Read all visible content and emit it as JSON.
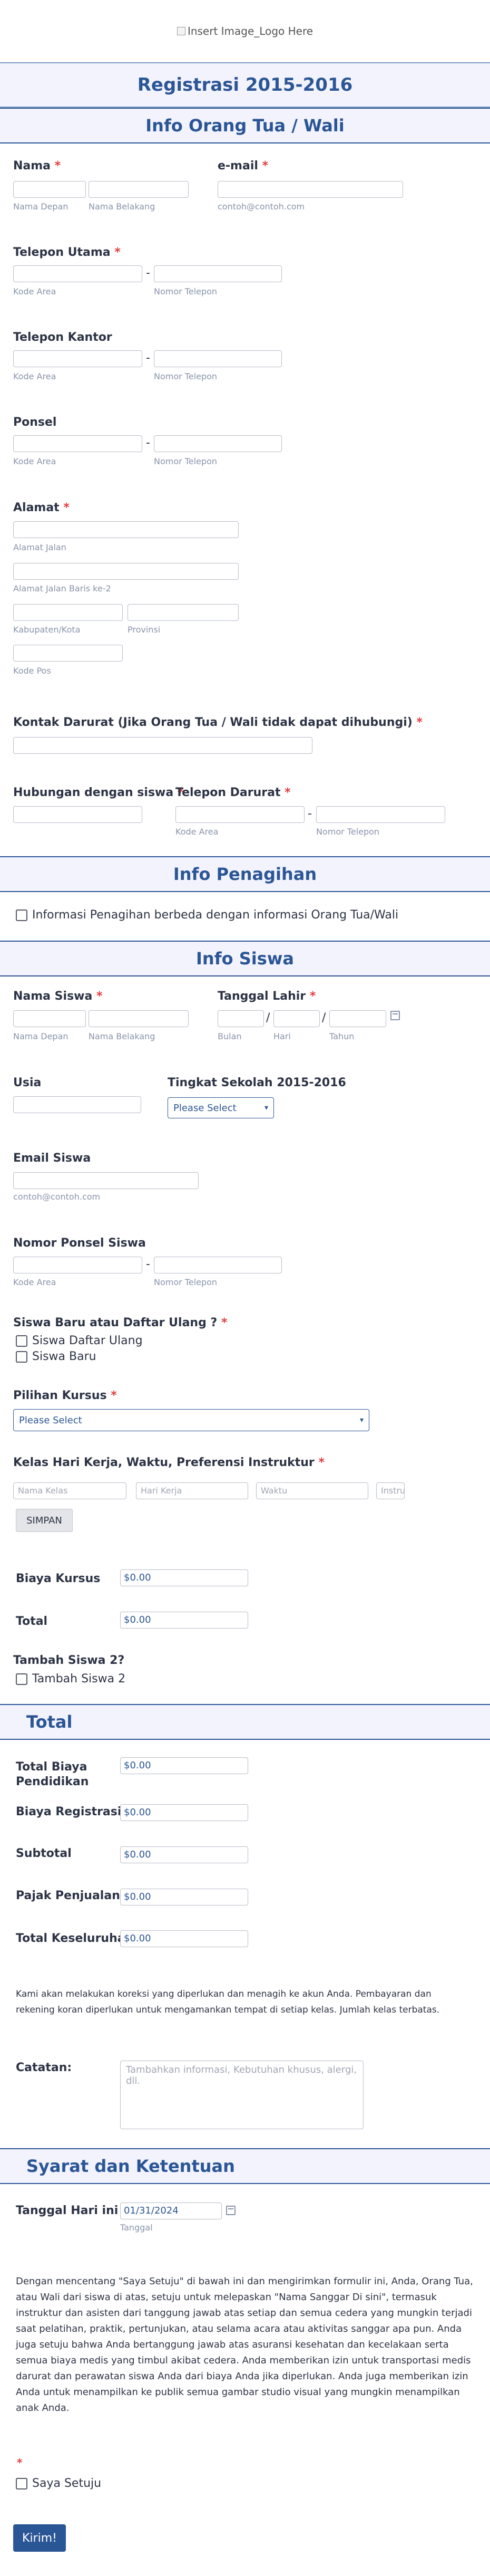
{
  "logo": {
    "alt": "Insert Image_Logo Here"
  },
  "form_title": "Registrasi 2015-2016",
  "sections": {
    "parent": "Info Orang Tua / Wali",
    "billing": "Info Penagihan",
    "student": "Info Siswa",
    "total": "Total",
    "terms": "Syarat dan Ketentuan"
  },
  "parent": {
    "name_label": "Nama",
    "first_sub": "Nama Depan",
    "last_sub": "Nama Belakang",
    "email_label": "e-mail",
    "email_sub": "contoh@contoh.com",
    "main_phone_label": "Telepon Utama",
    "office_phone_label": "Telepon Kantor",
    "cell_label": "Ponsel",
    "area_sub": "Kode Area",
    "number_sub": "Nomor Telepon",
    "dash": "-",
    "address_label": "Alamat",
    "street_sub": "Alamat Jalan",
    "street2_sub": "Alamat Jalan Baris ke-2",
    "city_sub": "Kabupaten/Kota",
    "province_sub": "Provinsi",
    "postal_sub": "Kode Pos",
    "emergency_label": "Kontak Darurat (Jika Orang Tua / Wali tidak dapat dihubungi)",
    "relationship_label": "Hubungan dengan siswa",
    "emergency_phone_label": "Telepon Darurat"
  },
  "billing": {
    "different_label": "Informasi Penagihan berbeda dengan informasi Orang Tua/Wali"
  },
  "student": {
    "name_label": "Nama Siswa",
    "birth_label": "Tanggal Lahir",
    "month_sub": "Bulan",
    "day_sub": "Hari",
    "year_sub": "Tahun",
    "slash": "/",
    "age_label": "Usia",
    "grade_label": "Tingkat Sekolah 2015-2016",
    "grade_select": "Please Select",
    "email_label": "Email Siswa",
    "cell_label": "Nomor Ponsel Siswa",
    "status_label": "Siswa Baru atau Daftar Ulang ?",
    "status_options": [
      "Siswa Daftar Ulang",
      "Siswa Baru"
    ],
    "course_label": "Pilihan Kursus",
    "course_select": "Please Select",
    "class_label": "Kelas Hari Kerja, Waktu, Preferensi Instruktur",
    "class_cols": [
      "Nama Kelas",
      "Hari Kerja",
      "Waktu",
      "Instru"
    ],
    "save_button": "SIMPAN",
    "course_fee_label": "Biaya Kursus",
    "course_fee": "$0.00",
    "total_label": "Total",
    "total_value": "$0.00",
    "add_label": "Tambah Siswa 2?",
    "add_option": "Tambah Siswa 2"
  },
  "total": {
    "rows": [
      {
        "label": "Total Biaya Pendidikan",
        "value": "$0.00"
      },
      {
        "label": "Biaya Registrasi",
        "value": "$0.00"
      },
      {
        "label": "Subtotal",
        "value": "$0.00"
      },
      {
        "label": "Pajak Penjualan",
        "value": "$0.00"
      },
      {
        "label": "Total Keseluruhan",
        "value": "$0.00"
      }
    ],
    "note": "Kami akan melakukan koreksi yang diperlukan dan menagih ke akun Anda. Pembayaran dan rekening koran diperlukan untuk mengamankan tempat di setiap kelas. Jumlah kelas terbatas.",
    "notes_label": "Catatan:",
    "notes_placeholder": "Tambahkan informasi, Kebutuhan khusus, alergi, dll."
  },
  "terms": {
    "date_label": "Tanggal Hari ini",
    "date_value": "01/31/2024",
    "date_sub": "Tanggal",
    "paragraph": "Dengan mencentang \"Saya Setuju\" di bawah ini dan mengirimkan formulir ini, Anda, Orang Tua, atau Wali dari siswa di atas, setuju untuk melepaskan \"Nama Sanggar Di sini\", termasuk instruktur dan asisten dari tanggung jawab atas setiap dan semua cedera yang mungkin terjadi saat pelatihan, praktik, pertunjukan, atau selama acara atau aktivitas sanggar apa pun. Anda juga setuju bahwa Anda bertanggung jawab atas asuransi kesehatan dan kecelakaan serta semua biaya medis yang timbul akibat cedera. Anda memberikan izin untuk transportasi medis darurat dan perawatan siswa Anda dari biaya Anda jika diperlukan. Anda juga memberikan izin Anda untuk menampilkan ke publik semua gambar studio visual yang mungkin menampilkan anak Anda.",
    "agree_label": "Saya Setuju",
    "submit": "Kirim!"
  },
  "required_mark": "*",
  "colors": {
    "accent": "#2b5695",
    "required": "#e13d3d",
    "section_bg": "#f3f3fe"
  }
}
